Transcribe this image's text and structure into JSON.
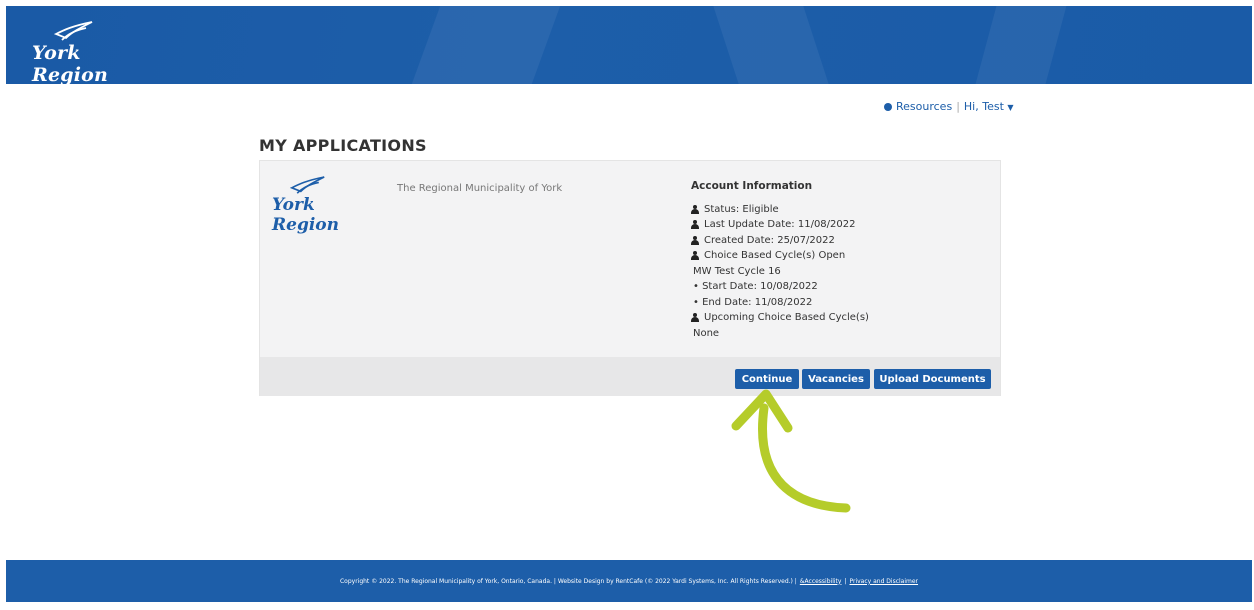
{
  "header": {
    "logo_text": "York Region"
  },
  "user_nav": {
    "resources_label": "Resources",
    "separator": "|",
    "greeting": "Hi, Test"
  },
  "page": {
    "title": "MY APPLICATIONS"
  },
  "card": {
    "logo_text": "York Region",
    "org_name": "The Regional Municipality of York",
    "account": {
      "heading": "Account Information",
      "status": "Status: Eligible",
      "last_update": "Last Update Date: 11/08/2022",
      "created": "Created Date: 25/07/2022",
      "cycles_open": "Choice Based Cycle(s) Open",
      "cycle_name": "MW Test Cycle 16",
      "start_date": "• Start Date: 10/08/2022",
      "end_date": "• End Date: 11/08/2022",
      "upcoming": "Upcoming Choice Based Cycle(s)",
      "upcoming_value": "None"
    },
    "buttons": {
      "continue": "Continue",
      "vacancies": "Vacancies",
      "upload": "Upload Documents"
    }
  },
  "footer": {
    "copyright": "Copyright © 2022. The Regional Municipality of York, Ontario, Canada. | Website Design by RentCafe (© 2022 Yardi Systems, Inc. All Rights Reserved.) |",
    "accessibility": "Accessibility",
    "sep": "|",
    "privacy": "Privacy and Disclaimer"
  },
  "colors": {
    "brand_blue": "#1d5ea9",
    "arrow_green": "#b5cc2a"
  }
}
